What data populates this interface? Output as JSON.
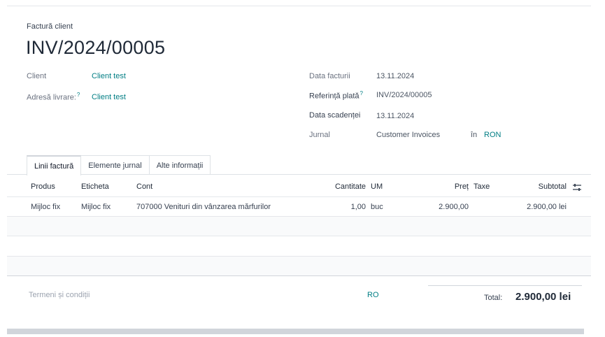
{
  "invoice": {
    "type_label": "Factură client",
    "name": "INV/2024/00005"
  },
  "fields_left": {
    "client_label": "Client",
    "client_value": "Client test",
    "delivery_label": "Adresă livrare:",
    "delivery_help": "?",
    "delivery_value": "Client test"
  },
  "fields_right": {
    "date_label": "Data facturii",
    "date_value": "13.11.2024",
    "payment_ref_label": "Referință plată",
    "payment_ref_help": "?",
    "payment_ref_value": "INV/2024/00005",
    "due_date_label": "Data scadenței",
    "due_date_value": "13.11.2024",
    "journal_label": "Jurnal",
    "journal_value": "Customer Invoices",
    "journal_in": "în",
    "currency": "RON"
  },
  "tabs": [
    {
      "label": "Linii factură",
      "active": true
    },
    {
      "label": "Elemente jurnal",
      "active": false
    },
    {
      "label": "Alte informații",
      "active": false
    }
  ],
  "table": {
    "headers": {
      "product": "Produs",
      "label": "Eticheta",
      "account": "Cont",
      "quantity": "Cantitate",
      "uom": "UM",
      "price": "Preț",
      "taxes": "Taxe",
      "subtotal": "Subtotal"
    },
    "rows": [
      {
        "product": "Mijloc fix",
        "label": "Mijloc fix",
        "account": "707000 Venituri din vânzarea mărfurilor",
        "quantity": "1,00",
        "uom": "buc",
        "price": "2.900,00",
        "taxes": "",
        "subtotal": "2.900,00 lei"
      }
    ]
  },
  "footer": {
    "terms_placeholder": "Termeni și condiții",
    "language": "RO",
    "total_label": "Total:",
    "total_value": "2.900,00 lei"
  },
  "colors": {
    "accent": "#017e84"
  }
}
